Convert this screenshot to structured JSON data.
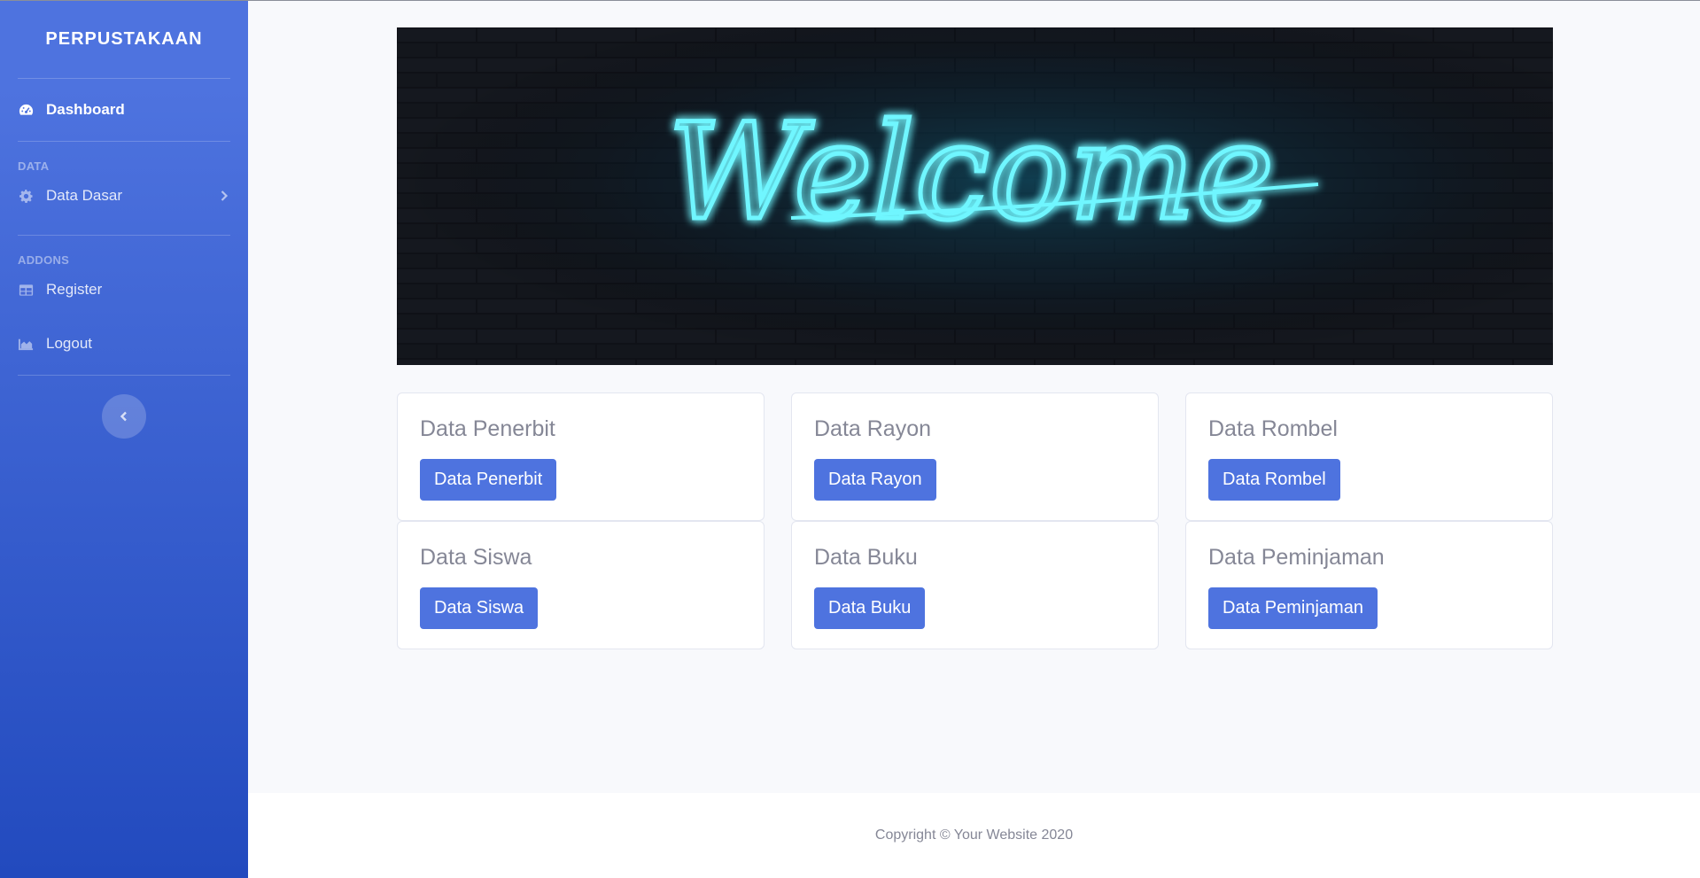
{
  "sidebar": {
    "brand": "PERPUSTAKAAN",
    "dashboard_label": "Dashboard",
    "heading_data": "DATA",
    "data_dasar_label": "Data Dasar",
    "heading_addons": "ADDONS",
    "register_label": "Register",
    "logout_label": "Logout"
  },
  "banner": {
    "text": "Welcome"
  },
  "cards": [
    {
      "title": "Data Penerbit",
      "button": "Data Penerbit"
    },
    {
      "title": "Data Rayon",
      "button": "Data Rayon"
    },
    {
      "title": "Data Rombel",
      "button": "Data Rombel"
    },
    {
      "title": "Data Siswa",
      "button": "Data Siswa"
    },
    {
      "title": "Data Buku",
      "button": "Data Buku"
    },
    {
      "title": "Data Peminjaman",
      "button": "Data Peminjaman"
    }
  ],
  "footer": {
    "copyright": "Copyright © Your Website 2020"
  },
  "colors": {
    "primary": "#4e73df",
    "sidebar_dark": "#224abe",
    "neon": "#5ff0ff"
  }
}
